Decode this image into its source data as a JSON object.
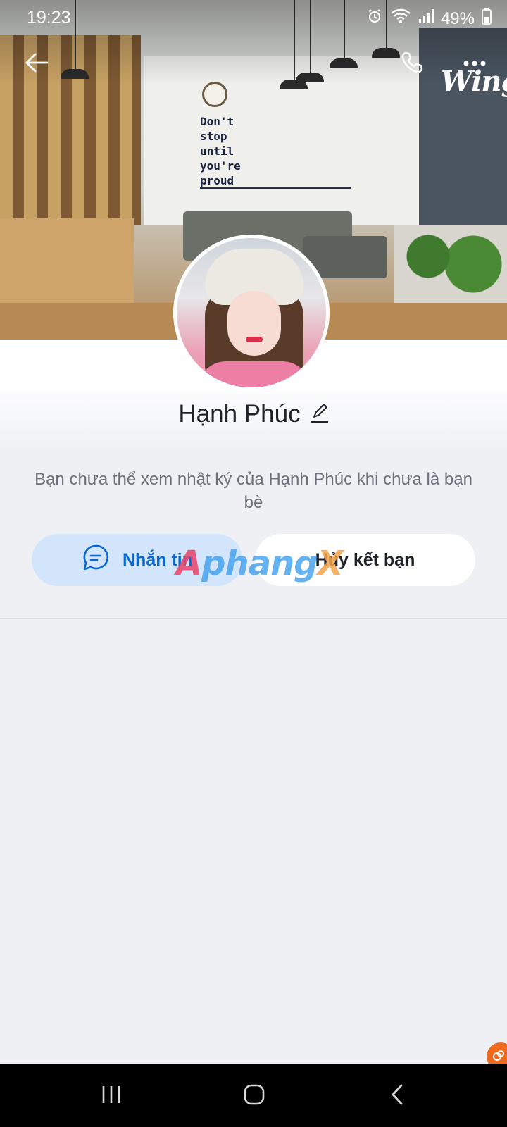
{
  "status_bar": {
    "time": "19:23",
    "battery": "49%"
  },
  "cover": {
    "quote": "Don't\nstop\nuntil\nyou're\nproud",
    "brand": "Wings"
  },
  "topbar": {
    "back_icon": "arrow-left-icon",
    "call_icon": "phone-icon",
    "more_icon": "more-horizontal-icon"
  },
  "profile": {
    "name": "Hạnh Phúc",
    "hint": "Bạn chưa thể xem nhật ký của Hạnh Phúc khi chưa là bạn bè"
  },
  "actions": {
    "message_label": "Nhắn tin",
    "unfriend_label": "Hủy kết bạn"
  },
  "watermark": {
    "part1": "A",
    "part2": "phang",
    "part3": "X"
  },
  "colors": {
    "accent": "#0a68d0",
    "message_bg": "#d3e5fb",
    "page_bg": "#eef0f4"
  }
}
